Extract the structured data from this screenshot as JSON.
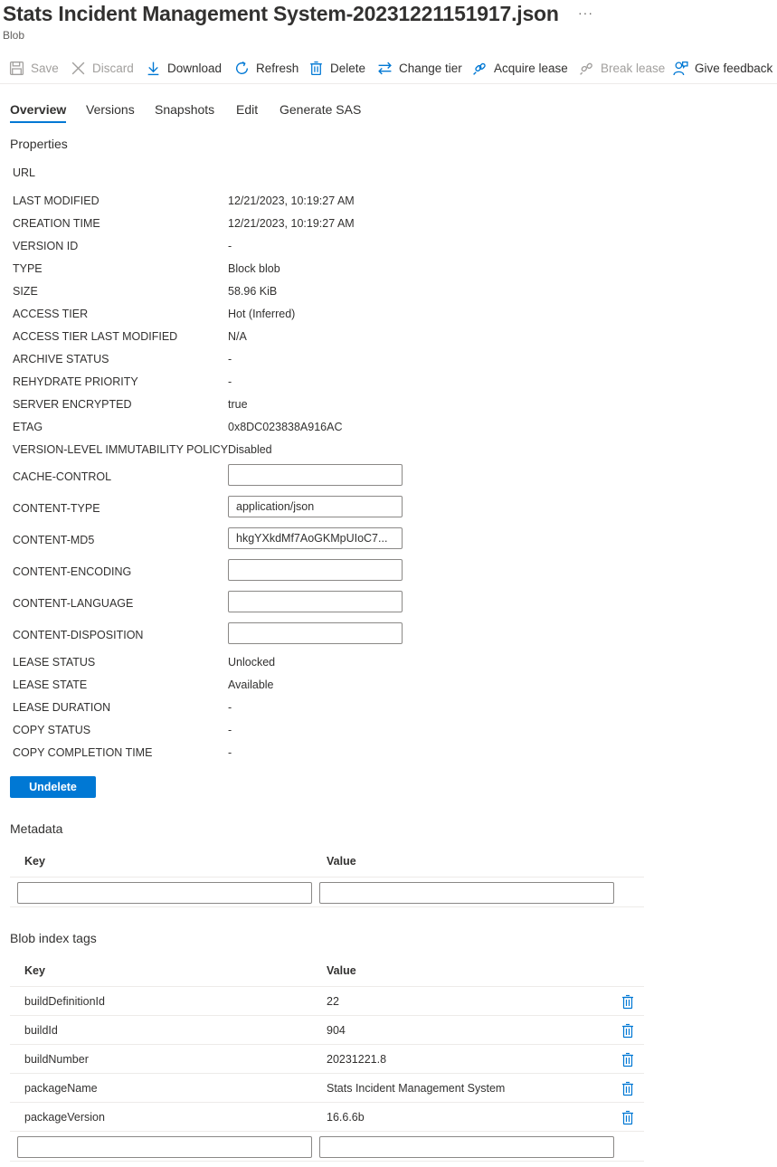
{
  "header": {
    "title": "Stats Incident Management System-20231221151917.json",
    "subtitle": "Blob",
    "more": "···"
  },
  "toolbar": {
    "save": "Save",
    "discard": "Discard",
    "download": "Download",
    "refresh": "Refresh",
    "delete": "Delete",
    "change_tier": "Change tier",
    "acquire_lease": "Acquire lease",
    "break_lease": "Break lease",
    "give_feedback": "Give feedback"
  },
  "tabs": [
    "Overview",
    "Versions",
    "Snapshots",
    "Edit",
    "Generate SAS"
  ],
  "properties": {
    "title": "Properties",
    "url_label": "URL",
    "rows": [
      {
        "label": "LAST MODIFIED",
        "value": "12/21/2023, 10:19:27 AM"
      },
      {
        "label": "CREATION TIME",
        "value": "12/21/2023, 10:19:27 AM"
      },
      {
        "label": "VERSION ID",
        "value": "-"
      },
      {
        "label": "TYPE",
        "value": "Block blob"
      },
      {
        "label": "SIZE",
        "value": "58.96 KiB"
      },
      {
        "label": "ACCESS TIER",
        "value": "Hot (Inferred)"
      },
      {
        "label": "ACCESS TIER LAST MODIFIED",
        "value": "N/A"
      },
      {
        "label": "ARCHIVE STATUS",
        "value": "-"
      },
      {
        "label": "REHYDRATE PRIORITY",
        "value": "-"
      },
      {
        "label": "SERVER ENCRYPTED",
        "value": "true"
      },
      {
        "label": "ETAG",
        "value": "0x8DC023838A916AC"
      },
      {
        "label": "VERSION-LEVEL IMMUTABILITY POLICY",
        "value": "Disabled"
      }
    ],
    "inputs": [
      {
        "label": "CACHE-CONTROL",
        "value": ""
      },
      {
        "label": "CONTENT-TYPE",
        "value": "application/json"
      },
      {
        "label": "CONTENT-MD5",
        "value": "hkgYXkdMf7AoGKMpUIoC7..."
      },
      {
        "label": "CONTENT-ENCODING",
        "value": ""
      },
      {
        "label": "CONTENT-LANGUAGE",
        "value": ""
      },
      {
        "label": "CONTENT-DISPOSITION",
        "value": ""
      }
    ],
    "lease_rows": [
      {
        "label": "LEASE STATUS",
        "value": "Unlocked"
      },
      {
        "label": "LEASE STATE",
        "value": "Available"
      },
      {
        "label": "LEASE DURATION",
        "value": "-"
      },
      {
        "label": "COPY STATUS",
        "value": "-"
      },
      {
        "label": "COPY COMPLETION TIME",
        "value": "-"
      }
    ]
  },
  "undelete_label": "Undelete",
  "metadata": {
    "title": "Metadata",
    "key_header": "Key",
    "value_header": "Value"
  },
  "tags": {
    "title": "Blob index tags",
    "key_header": "Key",
    "value_header": "Value",
    "rows": [
      {
        "key": "buildDefinitionId",
        "value": "22"
      },
      {
        "key": "buildId",
        "value": "904"
      },
      {
        "key": "buildNumber",
        "value": "20231221.8"
      },
      {
        "key": "packageName",
        "value": "Stats Incident Management System"
      },
      {
        "key": "packageVersion",
        "value": "16.6.6b"
      }
    ]
  },
  "colors": {
    "accent": "#0078d4",
    "disabled": "#a19f9d",
    "text": "#323130"
  }
}
